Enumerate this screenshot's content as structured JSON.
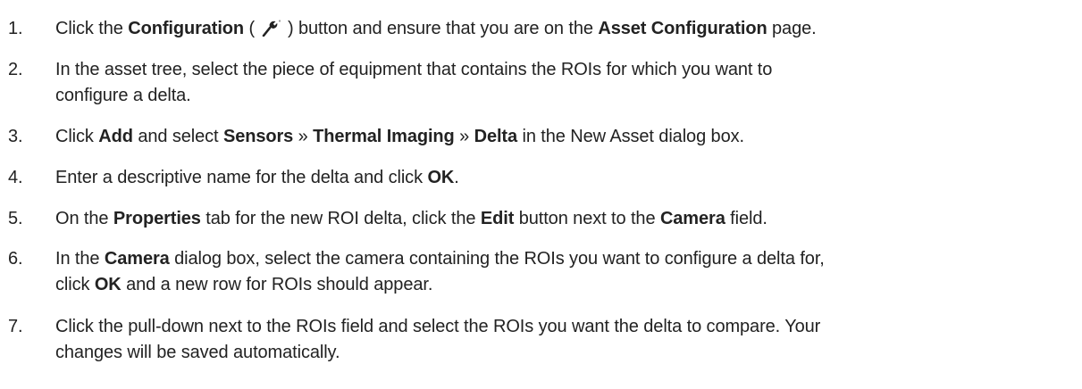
{
  "steps": [
    {
      "num": "1.",
      "t1": "Click the ",
      "b1": "Configuration",
      "t2": " ( ",
      "icon": "wrench-icon",
      "t3": " ) button and ensure that you are on the ",
      "b2": "Asset Configuration",
      "t4": " page."
    },
    {
      "num": "2.",
      "line1": "In the asset tree, select the piece of equipment that contains the ROIs for which you want to",
      "line2": "configure a delta."
    },
    {
      "num": "3.",
      "t1": "Click ",
      "b1": "Add",
      "t2": " and select ",
      "b2": "Sensors",
      "t3": " » ",
      "b3": "Thermal Imaging",
      "t4": " » ",
      "b4": "Delta",
      "t5": " in the New Asset dialog box."
    },
    {
      "num": "4.",
      "t1": "Enter a descriptive name for the delta and click ",
      "b1": "OK",
      "t2": "."
    },
    {
      "num": "5.",
      "t1": "On the ",
      "b1": "Properties",
      "t2": " tab for the new ROI delta, click the ",
      "b2": "Edit",
      "t3": " button next to the ",
      "b3": "Camera",
      "t4": " field."
    },
    {
      "num": "6.",
      "t1": "In the ",
      "b1": "Camera",
      "t2": " dialog box, select the camera containing the ROIs you want to configure a delta for,",
      "t3": "click ",
      "b2": "OK",
      "t4": " and a new row for ROIs should appear."
    },
    {
      "num": "7.",
      "line1": "Click the pull-down next to the ROIs field and select the ROIs you want the delta to compare. Your",
      "line2": "changes will be saved automatically."
    }
  ]
}
